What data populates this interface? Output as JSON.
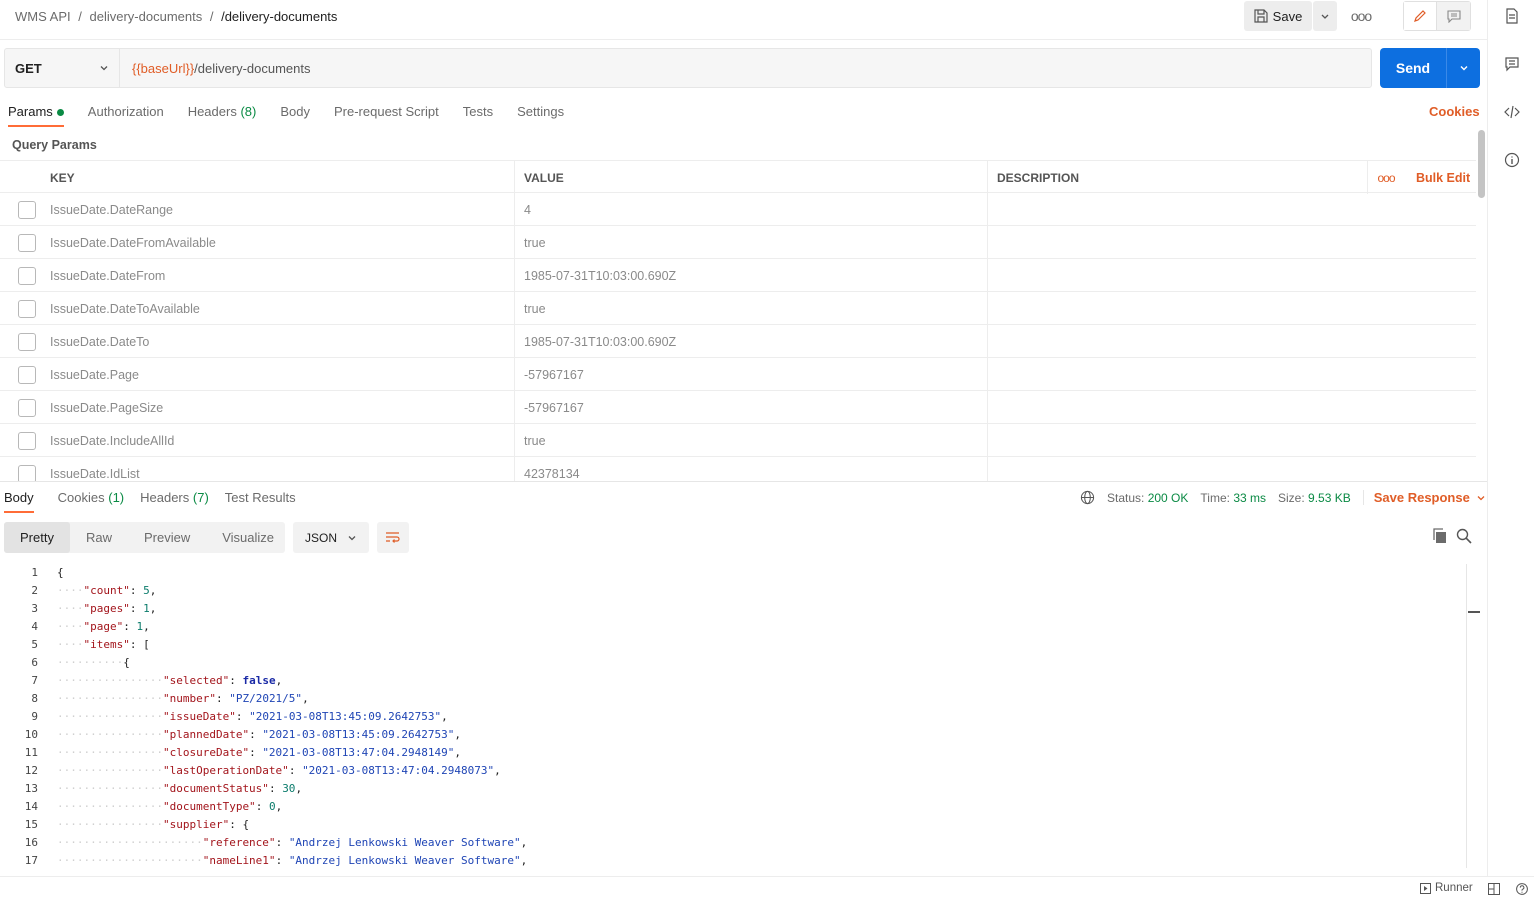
{
  "breadcrumb": {
    "collection": "WMS API",
    "folder": "delivery-documents",
    "request": "/delivery-documents",
    "separator": "/"
  },
  "toolbar": {
    "save_label": "Save",
    "more_label": "ooo"
  },
  "request": {
    "method": "GET",
    "url_variable": "{{baseUrl}}",
    "url_path": "/delivery-documents",
    "send_label": "Send"
  },
  "request_tabs": [
    {
      "label": "Params",
      "count": ""
    },
    {
      "label": "Authorization",
      "count": ""
    },
    {
      "label": "Headers",
      "count": "(8)"
    },
    {
      "label": "Body",
      "count": ""
    },
    {
      "label": "Pre-request Script",
      "count": ""
    },
    {
      "label": "Tests",
      "count": ""
    },
    {
      "label": "Settings",
      "count": ""
    }
  ],
  "cookies_label": "Cookies",
  "query_params": {
    "title": "Query Params",
    "headers": {
      "key": "KEY",
      "value": "VALUE",
      "description": "DESCRIPTION"
    },
    "bulk_dots": "ooo",
    "bulk_edit_label": "Bulk Edit",
    "rows": [
      {
        "key": "IssueDate.DateRange",
        "value": "4",
        "description": ""
      },
      {
        "key": "IssueDate.DateFromAvailable",
        "value": "true",
        "description": ""
      },
      {
        "key": "IssueDate.DateFrom",
        "value": "1985-07-31T10:03:00.690Z",
        "description": ""
      },
      {
        "key": "IssueDate.DateToAvailable",
        "value": "true",
        "description": ""
      },
      {
        "key": "IssueDate.DateTo",
        "value": "1985-07-31T10:03:00.690Z",
        "description": ""
      },
      {
        "key": "IssueDate.Page",
        "value": "-57967167",
        "description": ""
      },
      {
        "key": "IssueDate.PageSize",
        "value": "-57967167",
        "description": ""
      },
      {
        "key": "IssueDate.IncludeAllId",
        "value": "true",
        "description": ""
      },
      {
        "key": "IssueDate.IdList",
        "value": "42378134",
        "description": ""
      }
    ]
  },
  "response": {
    "tabs": [
      {
        "label": "Body",
        "count": ""
      },
      {
        "label": "Cookies",
        "count": "(1)"
      },
      {
        "label": "Headers",
        "count": "(7)"
      },
      {
        "label": "Test Results",
        "count": ""
      }
    ],
    "status_label": "Status:",
    "status_value": "200 OK",
    "time_label": "Time:",
    "time_value": "33 ms",
    "size_label": "Size:",
    "size_value": "9.53 KB",
    "save_response_label": "Save Response",
    "views": [
      "Pretty",
      "Raw",
      "Preview",
      "Visualize"
    ],
    "format": "JSON"
  },
  "code_lines": [
    {
      "n": "1",
      "indent": 0,
      "text": "{"
    },
    {
      "n": "2",
      "indent": 1,
      "key": "\"count\"",
      "val": "5",
      "vtype": "n",
      "tail": ","
    },
    {
      "n": "3",
      "indent": 1,
      "key": "\"pages\"",
      "val": "1",
      "vtype": "n",
      "tail": ","
    },
    {
      "n": "4",
      "indent": 1,
      "key": "\"page\"",
      "val": "1",
      "vtype": "n",
      "tail": ","
    },
    {
      "n": "5",
      "indent": 1,
      "key": "\"items\"",
      "val": "[",
      "vtype": "p",
      "tail": ""
    },
    {
      "n": "6",
      "indent": 2,
      "text": "{"
    },
    {
      "n": "7",
      "indent": 3,
      "key": "\"selected\"",
      "val": "false",
      "vtype": "b",
      "tail": ","
    },
    {
      "n": "8",
      "indent": 3,
      "key": "\"number\"",
      "val": "\"PZ/2021/5\"",
      "vtype": "s",
      "tail": ","
    },
    {
      "n": "9",
      "indent": 3,
      "key": "\"issueDate\"",
      "val": "\"2021-03-08T13:45:09.2642753\"",
      "vtype": "s",
      "tail": ","
    },
    {
      "n": "10",
      "indent": 3,
      "key": "\"plannedDate\"",
      "val": "\"2021-03-08T13:45:09.2642753\"",
      "vtype": "s",
      "tail": ","
    },
    {
      "n": "11",
      "indent": 3,
      "key": "\"closureDate\"",
      "val": "\"2021-03-08T13:47:04.2948149\"",
      "vtype": "s",
      "tail": ","
    },
    {
      "n": "12",
      "indent": 3,
      "key": "\"lastOperationDate\"",
      "val": "\"2021-03-08T13:47:04.2948073\"",
      "vtype": "s",
      "tail": ","
    },
    {
      "n": "13",
      "indent": 3,
      "key": "\"documentStatus\"",
      "val": "30",
      "vtype": "n",
      "tail": ","
    },
    {
      "n": "14",
      "indent": 3,
      "key": "\"documentType\"",
      "val": "0",
      "vtype": "n",
      "tail": ","
    },
    {
      "n": "15",
      "indent": 3,
      "key": "\"supplier\"",
      "val": "{",
      "vtype": "p",
      "tail": ""
    },
    {
      "n": "16",
      "indent": 4,
      "key": "\"reference\"",
      "val": "\"Andrzej Lenkowski Weaver Software\"",
      "vtype": "s",
      "tail": ","
    },
    {
      "n": "17",
      "indent": 4,
      "key": "\"nameLine1\"",
      "val": "\"Andrzej Lenkowski Weaver Software\"",
      "vtype": "s",
      "tail": ","
    }
  ],
  "footer": {
    "runner_label": "Runner"
  },
  "colors": {
    "accent": "#ff6c37",
    "send": "#0d6fe0",
    "success": "#0a8a44",
    "link": "#e05d27"
  },
  "icons": [
    "save-icon",
    "chevron-down-icon",
    "more-icon",
    "pencil-icon",
    "comment-icon",
    "documentation-icon",
    "comments-icon",
    "code-icon",
    "info-icon",
    "globe-icon",
    "copy-icon",
    "search-icon",
    "wrap-lines-icon",
    "runner-icon",
    "layout-icon",
    "help-icon"
  ]
}
